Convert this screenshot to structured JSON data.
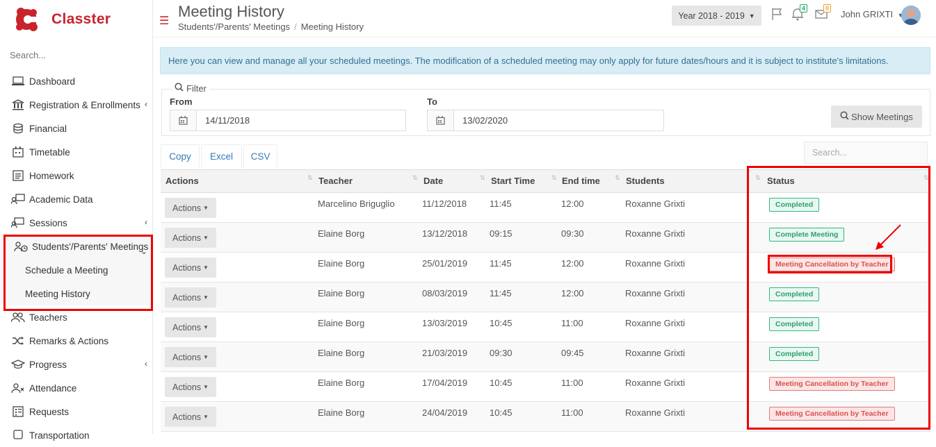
{
  "app": {
    "name": "Classter",
    "brand_color": "#c8232c"
  },
  "sidebar": {
    "search_placeholder": "Search...",
    "items": [
      {
        "label": "Dashboard",
        "icon": "laptop-icon"
      },
      {
        "label": "Registration & Enrollments",
        "icon": "bank-icon",
        "chevron": "‹"
      },
      {
        "label": "Financial",
        "icon": "coins-icon"
      },
      {
        "label": "Timetable",
        "icon": "calendar-icon"
      },
      {
        "label": "Homework",
        "icon": "list-icon"
      },
      {
        "label": "Academic Data",
        "icon": "chart-user-icon"
      },
      {
        "label": "Sessions",
        "icon": "sessions-icon",
        "chevron": "‹"
      },
      {
        "label": "Students'/Parents' Meetings",
        "icon": "meeting-clock-icon",
        "chevron": "⌄"
      },
      {
        "label": "Teachers",
        "icon": "users-icon"
      },
      {
        "label": "Remarks & Actions",
        "icon": "shuffle-icon"
      },
      {
        "label": "Progress",
        "icon": "graduation-cap-icon",
        "chevron": "‹"
      },
      {
        "label": "Attendance",
        "icon": "user-x-icon"
      },
      {
        "label": "Requests",
        "icon": "checklist-icon"
      },
      {
        "label": "Transportation",
        "icon": "bus-icon"
      }
    ],
    "subitems": [
      {
        "label": "Schedule a Meeting"
      },
      {
        "label": "Meeting History"
      }
    ]
  },
  "header": {
    "title": "Meeting History",
    "breadcrumb": [
      "Students'/Parents' Meetings",
      "Meeting History"
    ],
    "year_select": "Year 2018 - 2019",
    "notifications_count": "4",
    "messages_count": "0",
    "user_name": "John GRIXTI"
  },
  "info_text": "Here you can view and manage all your scheduled meetings. The modification of a scheduled meeting may only apply for future dates/hours and it is subject to institute's limitations.",
  "filter": {
    "legend": "Filter",
    "from_label": "From",
    "from_value": "14/11/2018",
    "to_label": "To",
    "to_value": "13/02/2020",
    "show_button": "Show Meetings"
  },
  "export": {
    "copy": "Copy",
    "excel": "Excel",
    "csv": "CSV",
    "search_placeholder": "Search..."
  },
  "table": {
    "columns": [
      "Actions",
      "Teacher",
      "Date",
      "Start Time",
      "End time",
      "Students",
      "Status"
    ],
    "action_label": "Actions",
    "rows": [
      {
        "teacher": "Marcelino Briguglio",
        "date": "11/12/2018",
        "start": "11:45",
        "end": "12:00",
        "students": "Roxanne Grixti",
        "status": "Completed",
        "status_type": "green"
      },
      {
        "teacher": "Elaine Borg",
        "date": "13/12/2018",
        "start": "09:15",
        "end": "09:30",
        "students": "Roxanne Grixti",
        "status": "Complete Meeting",
        "status_type": "green"
      },
      {
        "teacher": "Elaine Borg",
        "date": "25/01/2019",
        "start": "11:45",
        "end": "12:00",
        "students": "Roxanne Grixti",
        "status": "Meeting Cancellation by Teacher",
        "status_type": "red"
      },
      {
        "teacher": "Elaine Borg",
        "date": "08/03/2019",
        "start": "11:45",
        "end": "12:00",
        "students": "Roxanne Grixti",
        "status": "Completed",
        "status_type": "green"
      },
      {
        "teacher": "Elaine Borg",
        "date": "13/03/2019",
        "start": "10:45",
        "end": "11:00",
        "students": "Roxanne Grixti",
        "status": "Completed",
        "status_type": "green"
      },
      {
        "teacher": "Elaine Borg",
        "date": "21/03/2019",
        "start": "09:30",
        "end": "09:45",
        "students": "Roxanne Grixti",
        "status": "Completed",
        "status_type": "green"
      },
      {
        "teacher": "Elaine Borg",
        "date": "17/04/2019",
        "start": "10:45",
        "end": "11:00",
        "students": "Roxanne Grixti",
        "status": "Meeting Cancellation by Teacher",
        "status_type": "red"
      },
      {
        "teacher": "Elaine Borg",
        "date": "24/04/2019",
        "start": "10:45",
        "end": "11:00",
        "students": "Roxanne Grixti",
        "status": "Meeting Cancellation by Teacher",
        "status_type": "red"
      }
    ]
  }
}
